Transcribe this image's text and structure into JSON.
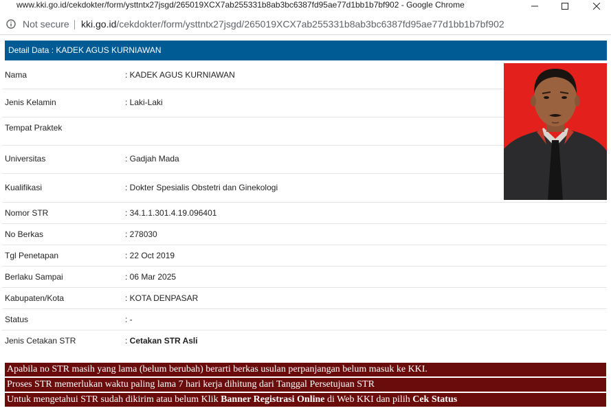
{
  "browser": {
    "window_title": "www.kki.go.id/cekdokter/form/ysttntx27jsgd/265019XCX7ab255331b8ab3bc6387fd95ae77d1bb1b7bf902 - Google Chrome",
    "security_label": "Not secure",
    "url_host": "kki.go.id",
    "url_path": "/cekdokter/form/ysttntx27jsgd/265019XCX7ab255331b8ab3bc6387fd95ae77d1bb1b7bf902"
  },
  "detail": {
    "header": "Detail Data : KADEK AGUS KURNIAWAN",
    "rows": [
      {
        "label": "Nama",
        "value": ": KADEK AGUS KURNIAWAN"
      },
      {
        "label": "Jenis Kelamin",
        "value": ": Laki-Laki"
      },
      {
        "label": "Tempat Praktek",
        "value": ""
      },
      {
        "label": "Universitas",
        "value": ": Gadjah Mada"
      },
      {
        "label": "Kualifikasi",
        "value": ": Dokter Spesialis Obstetri dan Ginekologi"
      },
      {
        "label": "Nomor STR",
        "value": ": 34.1.1.301.4.19.096401"
      },
      {
        "label": "No Berkas",
        "value": ": 278030"
      },
      {
        "label": "Tgl Penetapan",
        "value": ": 22 Oct 2019"
      },
      {
        "label": "Berlaku Sampai",
        "value": ": 06 Mar 2025"
      },
      {
        "label": "Kabupaten/Kota",
        "value": ": KOTA DENPASAR"
      },
      {
        "label": "Status",
        "value": ": -"
      },
      {
        "label": "Jenis Cetakan STR",
        "value_prefix": ": ",
        "value_bold": "Cetakan STR Asli"
      }
    ]
  },
  "notices": {
    "line1": "Apabila no STR masih yang lama (belum berubah) berarti berkas usulan perpanjangan belum masuk ke KKI.",
    "line2": "Proses STR memerlukan waktu paling lama 7 hari kerja dihitung dari Tanggal Persetujuan STR",
    "line3_a": "Untuk mengetahui STR sudah dikirim atau belum Klik ",
    "line3_b": "Banner Registrasi Online",
    "line3_c": " di Web KKI dan pilih ",
    "line3_d": "Cek Status"
  },
  "colors": {
    "header_bar": "#005b94",
    "notice_bg": "#6b0c0c",
    "photo_bg": "#e8231d"
  }
}
